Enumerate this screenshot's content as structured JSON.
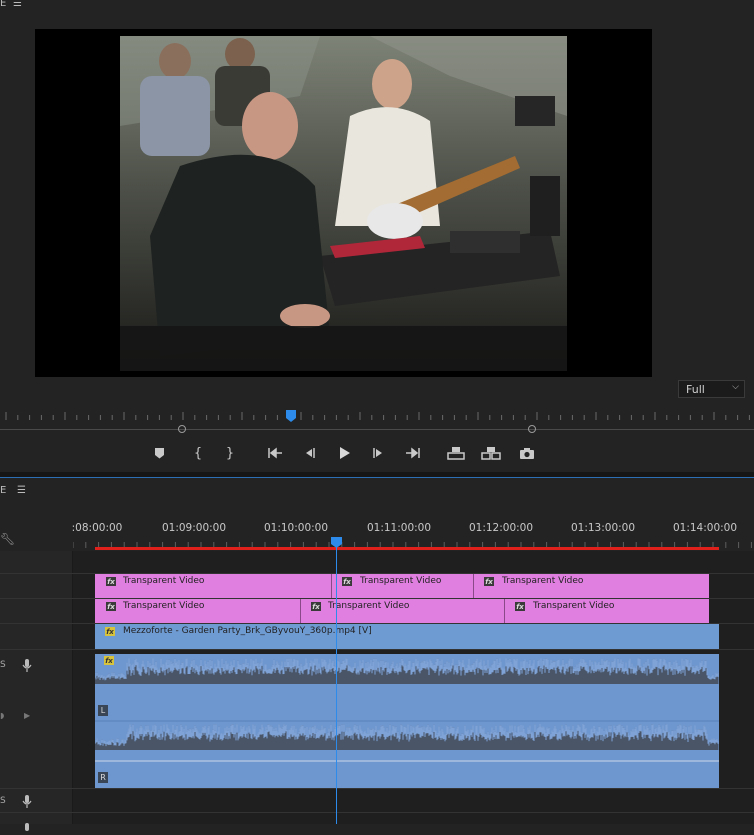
{
  "program_monitor": {
    "panel_title_fragment": "E",
    "panel_menu_icon": "hamburger-menu-icon",
    "video_frame": "band performance video frame",
    "zoom_select": {
      "value": "Full",
      "icon": "chevron-down-icon"
    },
    "playhead_color": "#2d8ceb"
  },
  "transport": {
    "buttons": [
      {
        "name": "add-marker-button",
        "icon": "marker-icon",
        "glyph": "⬟"
      },
      {
        "name": "mark-in-button",
        "icon": "mark-in-icon",
        "glyph": "{"
      },
      {
        "name": "mark-out-button",
        "icon": "mark-out-icon",
        "glyph": "}"
      },
      {
        "name": "go-to-in-button",
        "icon": "go-to-in-icon",
        "glyph": "|◀"
      },
      {
        "name": "step-back-button",
        "icon": "step-back-icon",
        "glyph": "◀|"
      },
      {
        "name": "play-button",
        "icon": "play-icon",
        "glyph": "▶"
      },
      {
        "name": "step-forward-button",
        "icon": "step-forward-icon",
        "glyph": "|▶"
      },
      {
        "name": "go-to-out-button",
        "icon": "go-to-out-icon",
        "glyph": "▶}"
      },
      {
        "name": "lift-button",
        "icon": "lift-icon",
        "glyph": "⊓"
      },
      {
        "name": "extract-button",
        "icon": "extract-icon",
        "glyph": "⊓⊓"
      },
      {
        "name": "export-frame-button",
        "icon": "camera-icon",
        "glyph": "◙"
      }
    ]
  },
  "timeline": {
    "panel_title_fragment": "E",
    "panel_menu_icon": "hamburger-menu-icon",
    "wrench_icon": "wrench-icon",
    "ruler_labels": [
      ":08:00:00",
      "01:09:00:00",
      "01:10:00:00",
      "01:11:00:00",
      "01:12:00:00",
      "01:13:00:00",
      "01:14:00:00"
    ],
    "tracks": {
      "v3": [
        {
          "label": "Transparent Video"
        },
        {
          "label": "Transparent Video"
        },
        {
          "label": "Transparent Video"
        }
      ],
      "v2": [
        {
          "label": "Transparent Video"
        },
        {
          "label": "Transparent Video"
        },
        {
          "label": "Transparent Video"
        }
      ],
      "v1": {
        "label": "Mezzoforte - Garden Party_Brk_GByvouY_360p.mp4 [V]"
      },
      "a1": {
        "channel_left": "L",
        "channel_right": "R",
        "fx_badge": "fx"
      },
      "a1_header_fragment": "S",
      "a2_header_fragment": "S"
    },
    "colors": {
      "transparent_clip": "#e07fe0",
      "video_clip": "#6f9bd3",
      "audio_clip": "#6f97cf",
      "render_bar": "#e0201a",
      "playhead": "#2d8ceb"
    }
  }
}
